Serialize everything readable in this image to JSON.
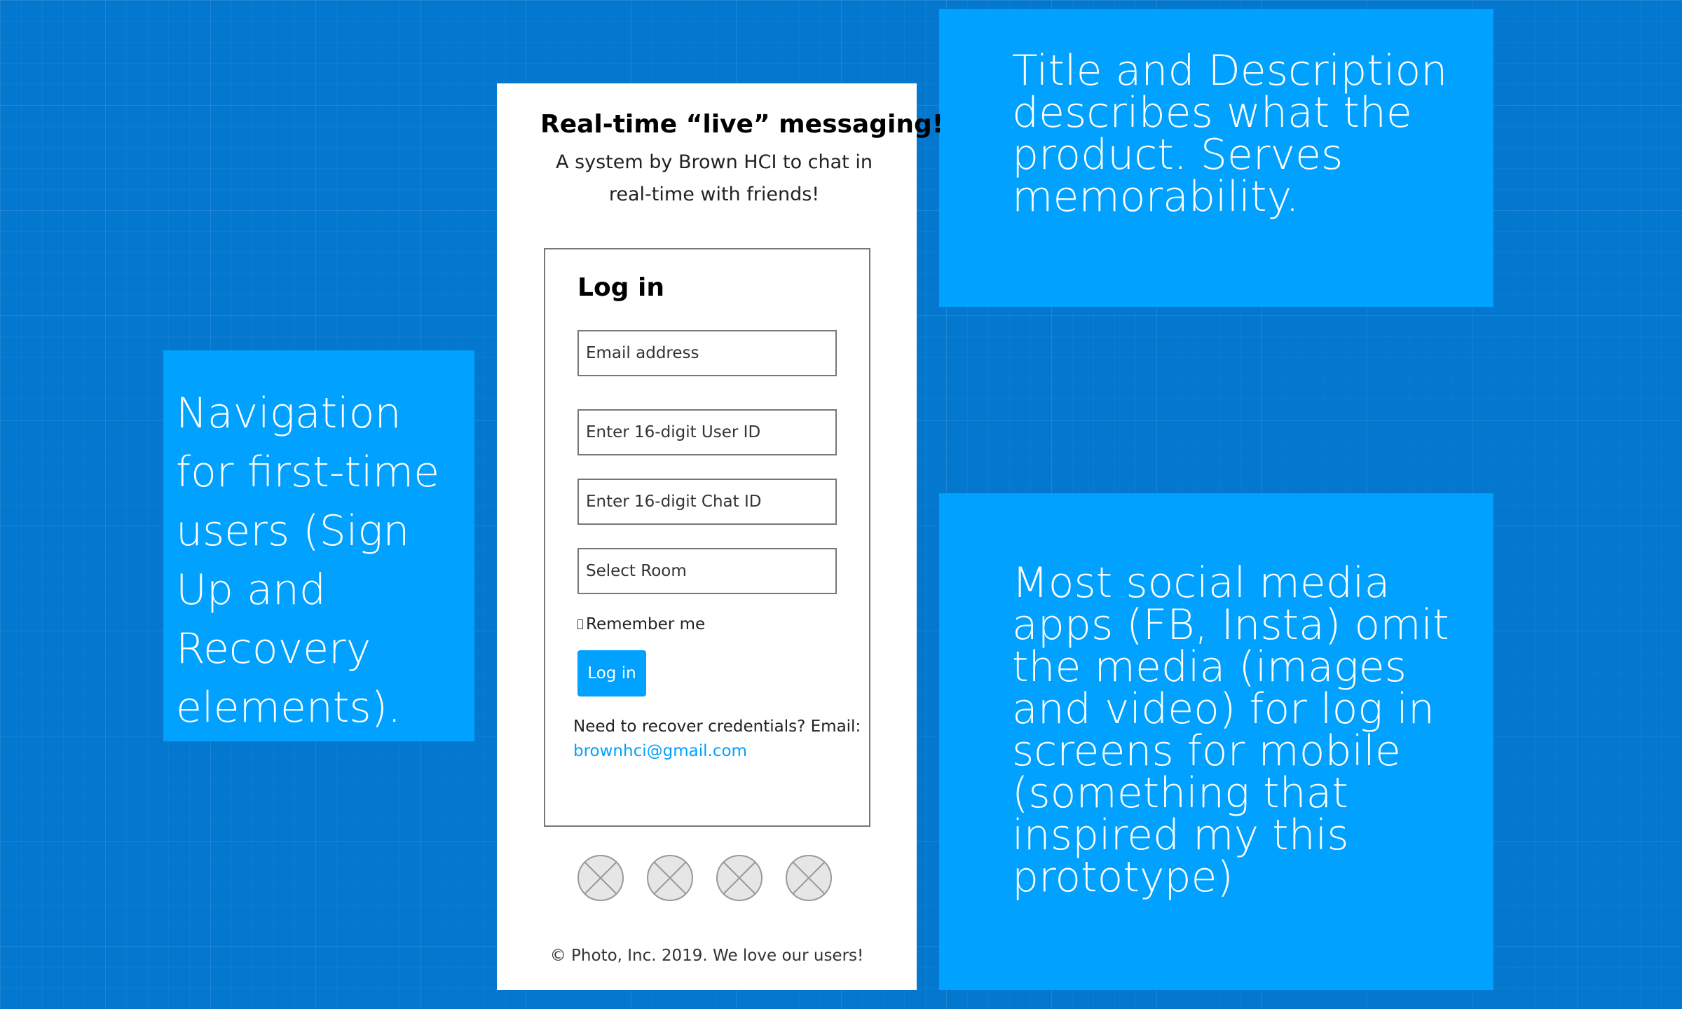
{
  "notes": {
    "navigation": "Navigation for first-time users (Sign Up and Recovery elements).",
    "title_description": "Title and Description describes what the product. Serves memorability.",
    "social_media": "Most social media apps (FB, Insta) omit the media (images and video) for log in screens for mobile (something that inspired my this prototype)"
  },
  "app": {
    "title": "Real-time “live” messaging!",
    "description": "A system by Brown HCI to chat in real-time with friends!"
  },
  "login": {
    "heading": "Log in",
    "email_placeholder": "Email address",
    "userid_placeholder": "Enter 16-digit User ID",
    "chatid_placeholder": "Enter 16-digit Chat ID",
    "room_placeholder": "Select Room",
    "remember_label": "Remember me",
    "button_label": "Log in",
    "recover_text": "Need to recover credentials? Email:",
    "recover_email": "brownhci@gmail.com"
  },
  "social_icons": [
    "image-placeholder-icon",
    "image-placeholder-icon",
    "image-placeholder-icon",
    "image-placeholder-icon"
  ],
  "footer": "© Photo, Inc. 2019. We love our users!",
  "colors": {
    "background": "#0477cf",
    "note": "#00a1ff",
    "accent": "#00a1ff",
    "phone": "#ffffff"
  }
}
